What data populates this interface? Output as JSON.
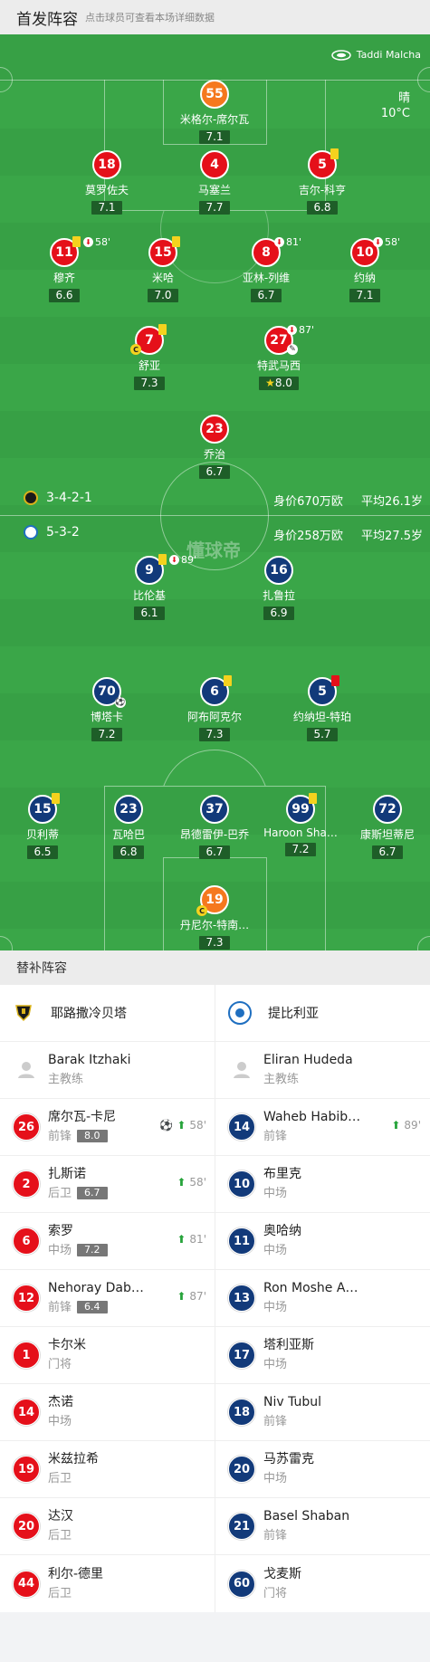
{
  "header": {
    "title": "首发阵容",
    "subtitle": "点击球员可查看本场详细数据"
  },
  "venue": "Taddi Malcha",
  "weather": {
    "condition": "晴",
    "temp": "10°C"
  },
  "watermark": "懂球帝",
  "home": {
    "formation": "3-4-2-1",
    "value": "身价670万欧",
    "avg_age": "平均26.1岁",
    "players": [
      {
        "num": "55",
        "name": "米格尔-席尔瓦",
        "rating": "7.1"
      },
      {
        "num": "18",
        "name": "莫罗佐夫",
        "rating": "7.1"
      },
      {
        "num": "4",
        "name": "马塞兰",
        "rating": "7.7"
      },
      {
        "num": "5",
        "name": "吉尔-科亨",
        "rating": "6.8"
      },
      {
        "num": "11",
        "name": "穆齐",
        "rating": "6.6",
        "sub": "58'"
      },
      {
        "num": "15",
        "name": "米哈",
        "rating": "7.0"
      },
      {
        "num": "8",
        "name": "亚林-列维",
        "rating": "6.7",
        "sub": "81'"
      },
      {
        "num": "10",
        "name": "约纳",
        "rating": "7.1",
        "sub": "58'"
      },
      {
        "num": "7",
        "name": "舒亚",
        "rating": "7.3"
      },
      {
        "num": "27",
        "name": "特武马西",
        "rating": "8.0",
        "sub": "87'"
      },
      {
        "num": "23",
        "name": "乔治",
        "rating": "6.7"
      }
    ]
  },
  "away": {
    "formation": "5-3-2",
    "value": "身价258万欧",
    "avg_age": "平均27.5岁",
    "players": [
      {
        "num": "9",
        "name": "比伦基",
        "rating": "6.1",
        "sub": "89'"
      },
      {
        "num": "16",
        "name": "扎鲁拉",
        "rating": "6.9"
      },
      {
        "num": "70",
        "name": "博塔卡",
        "rating": "7.2"
      },
      {
        "num": "6",
        "name": "阿布阿克尔",
        "rating": "7.3"
      },
      {
        "num": "5",
        "name": "约纳坦-特珀",
        "rating": "5.7"
      },
      {
        "num": "15",
        "name": "贝利蒂",
        "rating": "6.5"
      },
      {
        "num": "23",
        "name": "瓦哈巴",
        "rating": "6.8"
      },
      {
        "num": "37",
        "name": "昂德雷伊-巴乔",
        "rating": "6.7"
      },
      {
        "num": "99",
        "name": "Haroon Sha…",
        "rating": "7.2"
      },
      {
        "num": "72",
        "name": "康斯坦蒂尼",
        "rating": "6.7"
      },
      {
        "num": "19",
        "name": "丹尼尔-特南…",
        "rating": "7.3"
      }
    ]
  },
  "subs_title": "替补阵容",
  "bench": {
    "home_team": "耶路撒冷贝塔",
    "away_team": "提比利亚",
    "home_coach": {
      "name": "Barak Itzhaki",
      "role": "主教练"
    },
    "away_coach": {
      "name": "Eliran Hudeda",
      "role": "主教练"
    },
    "home": [
      {
        "num": "26",
        "name": "席尔瓦-卡尼",
        "pos": "前锋",
        "rating": "8.0",
        "event": "58'"
      },
      {
        "num": "2",
        "name": "扎斯诺",
        "pos": "后卫",
        "rating": "6.7",
        "event": "58'"
      },
      {
        "num": "6",
        "name": "索罗",
        "pos": "中场",
        "rating": "7.2",
        "event": "81'"
      },
      {
        "num": "12",
        "name": "Nehoray Dab…",
        "pos": "前锋",
        "rating": "6.4",
        "event": "87'"
      },
      {
        "num": "1",
        "name": "卡尔米",
        "pos": "门将"
      },
      {
        "num": "14",
        "name": "杰诺",
        "pos": "中场"
      },
      {
        "num": "19",
        "name": "米兹拉希",
        "pos": "后卫"
      },
      {
        "num": "20",
        "name": "达汉",
        "pos": "后卫"
      },
      {
        "num": "44",
        "name": "利尔-德里",
        "pos": "后卫"
      }
    ],
    "away": [
      {
        "num": "14",
        "name": "Waheb Habib…",
        "pos": "前锋",
        "event": "89'"
      },
      {
        "num": "10",
        "name": "布里克",
        "pos": "中场"
      },
      {
        "num": "11",
        "name": "奥哈纳",
        "pos": "中场"
      },
      {
        "num": "13",
        "name": "Ron Moshe A…",
        "pos": "中场"
      },
      {
        "num": "17",
        "name": "塔利亚斯",
        "pos": "中场"
      },
      {
        "num": "18",
        "name": "Niv Tubul",
        "pos": "前锋"
      },
      {
        "num": "20",
        "name": "马苏雷克",
        "pos": "中场"
      },
      {
        "num": "21",
        "name": "Basel Shaban",
        "pos": "前锋"
      },
      {
        "num": "60",
        "name": "戈麦斯",
        "pos": "门将"
      }
    ]
  },
  "colors": {
    "home": "#e5101a",
    "home_gk": "#f5781e",
    "away": "#123a7a",
    "pitch": "#3aa648"
  }
}
